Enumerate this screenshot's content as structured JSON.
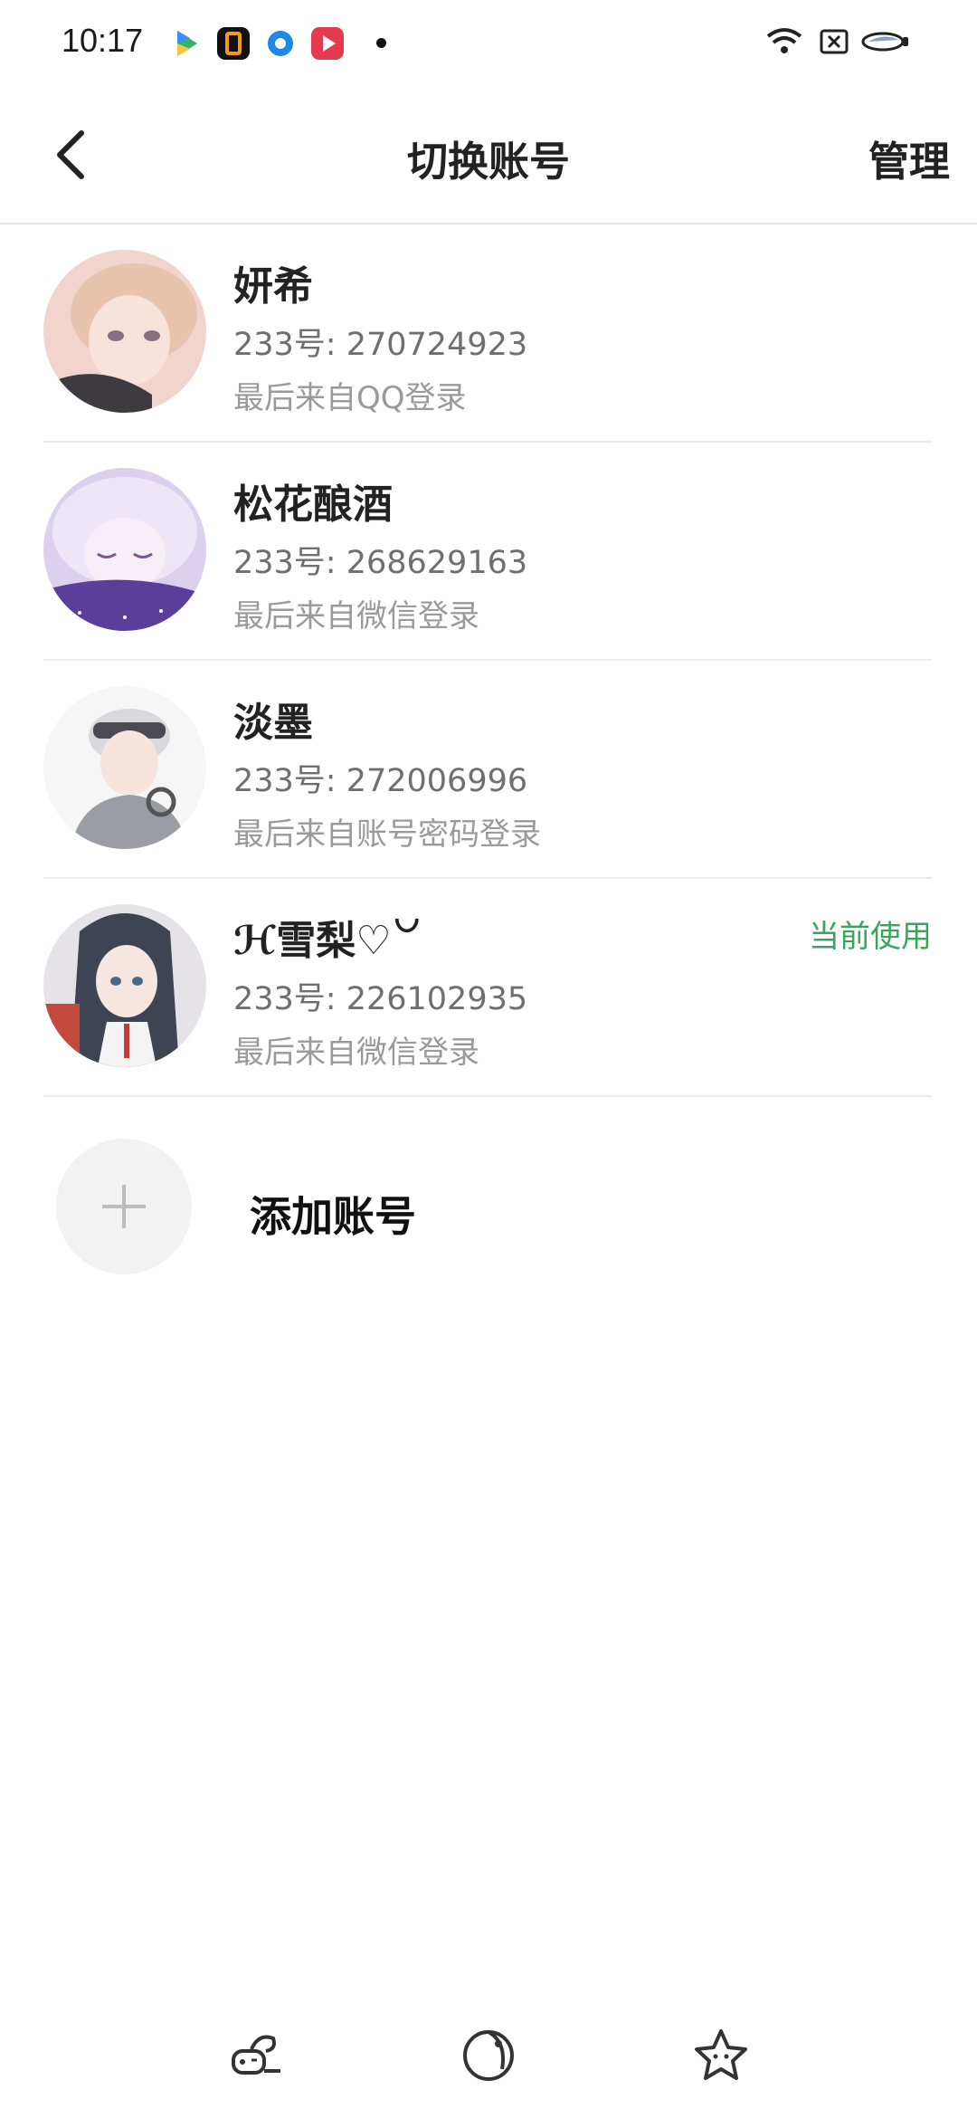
{
  "status_bar": {
    "time": "10:17"
  },
  "header": {
    "title": "切换账号",
    "manage_label": "管理"
  },
  "accounts": [
    {
      "name": "妍希",
      "id_text": "233号: 270724923",
      "login_text": "最后来自QQ登录",
      "avatar_colors": [
        "#f4d6cf",
        "#e7b9b4"
      ]
    },
    {
      "name": "松花酿酒",
      "id_text": "233号: 268629163",
      "login_text": "最后来自微信登录",
      "avatar_colors": [
        "#d9c9ef",
        "#8e74c9"
      ]
    },
    {
      "name": "淡墨",
      "id_text": "233号: 272006996",
      "login_text": "最后来自账号密码登录",
      "avatar_colors": [
        "#f3f3f3",
        "#c9c9cf"
      ]
    },
    {
      "name": "ℋ雪梨♡꒡",
      "id_text": "233号: 226102935",
      "login_text": "最后来自微信登录",
      "badge": "当前使用",
      "avatar_colors": [
        "#e9e4ea",
        "#3f4656"
      ]
    }
  ],
  "add_account": {
    "label": "添加账号",
    "icon": "plus-icon"
  },
  "bottom_icons": [
    "game-controller-icon",
    "planet-icon",
    "star-face-icon"
  ],
  "colors": {
    "accent_green": "#3aa35c",
    "divider": "#ececec"
  }
}
